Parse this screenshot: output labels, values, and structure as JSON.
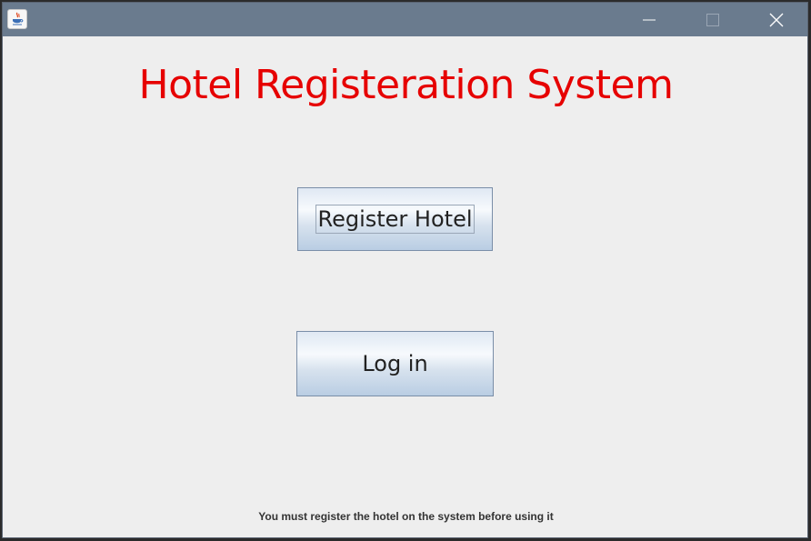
{
  "window": {
    "title": "",
    "icon": "java-cup-icon",
    "controls": [
      "minimize-icon",
      "maximize-icon",
      "close-icon"
    ]
  },
  "main": {
    "title": "Hotel Registeration System",
    "title_color": "#e60000",
    "register_label": "Register Hotel",
    "login_label": "Log in",
    "footer_note": "You must register the hotel on the system before using it"
  }
}
